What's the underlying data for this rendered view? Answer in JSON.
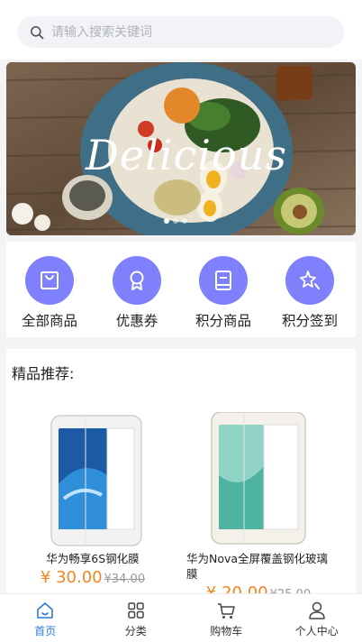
{
  "search": {
    "placeholder": "请输入搜索关键词"
  },
  "banner": {
    "text": "Delicious"
  },
  "categories": [
    {
      "label": "全部商品",
      "icon": "shopping-bag-icon"
    },
    {
      "label": "优惠券",
      "icon": "award-icon"
    },
    {
      "label": "积分商品",
      "icon": "book-icon"
    },
    {
      "label": "积分签到",
      "icon": "sparkle-star-icon"
    }
  ],
  "recommend": {
    "title": "精品推荐:",
    "products": [
      {
        "name": "华为畅享6S钢化膜",
        "price": "¥ 30.00",
        "old_price": "¥34.00"
      },
      {
        "name": "华为Nova全屏覆盖钢化玻璃膜",
        "price": "¥ 20.00",
        "old_price": "¥25.00"
      }
    ]
  },
  "tabbar": [
    {
      "label": "首页",
      "icon": "home-icon",
      "active": true
    },
    {
      "label": "分类",
      "icon": "grid-icon",
      "active": false
    },
    {
      "label": "购物车",
      "icon": "cart-icon",
      "active": false
    },
    {
      "label": "个人中心",
      "icon": "user-icon",
      "active": false
    }
  ],
  "colors": {
    "accent": "#7f80fb",
    "price": "#f2851f",
    "tab_active": "#2d7bd8"
  }
}
